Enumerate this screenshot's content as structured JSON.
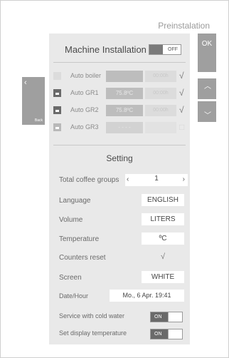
{
  "header": {
    "title": "Preinstalation"
  },
  "machine_installation": {
    "label": "Machine Installation",
    "switch": "OFF"
  },
  "boilers": [
    {
      "label": "Auto boiler",
      "temp": "",
      "setpoint": "00:00h",
      "checked": true
    },
    {
      "label": "Auto GR1",
      "temp": "75.8ºC",
      "setpoint": "00:00h",
      "checked": true
    },
    {
      "label": "Auto GR2",
      "temp": "75.8ºC",
      "setpoint": "00:00h",
      "checked": true
    },
    {
      "label": "Auto GR3",
      "temp": "- - - -",
      "setpoint": "",
      "checked": false
    }
  ],
  "setting": {
    "title": "Setting",
    "total_coffee_groups": {
      "label": "Total coffee groups",
      "value": "1",
      "left": "‹",
      "right": "›"
    },
    "language": {
      "label": "Language",
      "value": "ENGLISH"
    },
    "volume": {
      "label": "Volume",
      "value": "LITERS"
    },
    "temperature": {
      "label": "Temperature",
      "value": "ºC"
    },
    "counters_reset": {
      "label": "Counters reset",
      "value": "√"
    },
    "screen": {
      "label": "Screen",
      "value": "WHITE"
    },
    "date_hour": {
      "label": "Date/Hour",
      "value": "Mo., 6 Apr. 19:41"
    },
    "service_cold_water": {
      "label": "Service with cold water",
      "switch": "ON"
    },
    "set_display_temperature": {
      "label": "Set display temperature",
      "switch": "ON"
    }
  },
  "buttons": {
    "back_chevron": "‹",
    "back_label": "Back",
    "ok": "OK",
    "up": "︿",
    "down": "﹀"
  }
}
